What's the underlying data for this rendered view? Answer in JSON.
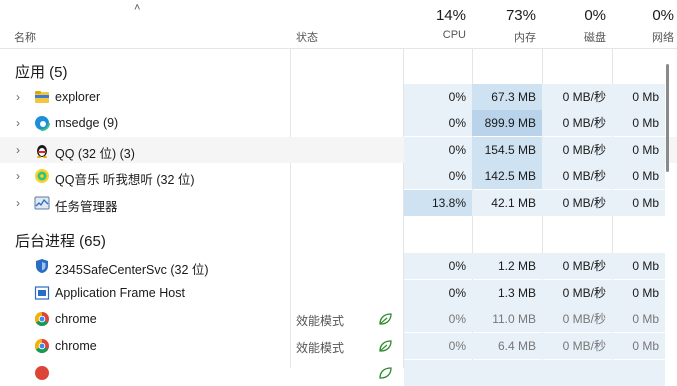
{
  "header": {
    "name_label": "名称",
    "status_label": "状态",
    "cpu": {
      "pct": "14%",
      "label": "CPU"
    },
    "memory": {
      "pct": "73%",
      "label": "内存"
    },
    "disk": {
      "pct": "0%",
      "label": "磁盘"
    },
    "network": {
      "pct": "0%",
      "label": "网络"
    }
  },
  "sections": {
    "apps_title": "应用 (5)",
    "background_title": "后台进程 (65)"
  },
  "apps": [
    {
      "name": "explorer",
      "cpu": "0%",
      "memory": "67.3 MB",
      "disk": "0 MB/秒",
      "network": "0 Mb"
    },
    {
      "name": "msedge (9)",
      "cpu": "0%",
      "memory": "899.9 MB",
      "disk": "0 MB/秒",
      "network": "0 Mb"
    },
    {
      "name": "QQ (32 位) (3)",
      "cpu": "0%",
      "memory": "154.5 MB",
      "disk": "0 MB/秒",
      "network": "0 Mb"
    },
    {
      "name": "QQ音乐 听我想听 (32 位)",
      "cpu": "0%",
      "memory": "142.5 MB",
      "disk": "0 MB/秒",
      "network": "0 Mb"
    },
    {
      "name": "任务管理器",
      "cpu": "13.8%",
      "memory": "42.1 MB",
      "disk": "0 MB/秒",
      "network": "0 Mb"
    }
  ],
  "background": [
    {
      "name": "2345SafeCenterSvc (32 位)",
      "status": "",
      "cpu": "0%",
      "memory": "1.2 MB",
      "disk": "0 MB/秒",
      "network": "0 Mb"
    },
    {
      "name": "Application Frame Host",
      "status": "",
      "cpu": "0%",
      "memory": "1.3 MB",
      "disk": "0 MB/秒",
      "network": "0 Mb"
    },
    {
      "name": "chrome",
      "status": "效能模式",
      "cpu": "0%",
      "memory": "11.0 MB",
      "disk": "0 MB/秒",
      "network": "0 Mb"
    },
    {
      "name": "chrome",
      "status": "效能模式",
      "cpu": "0%",
      "memory": "6.4 MB",
      "disk": "0 MB/秒",
      "network": "0 Mb"
    }
  ],
  "colors": {
    "heat_light": "#e8f1f8",
    "heat_mid": "#cfe2f1",
    "heat_strong": "#b9d4ea",
    "accent_green": "#2e8b2e"
  }
}
